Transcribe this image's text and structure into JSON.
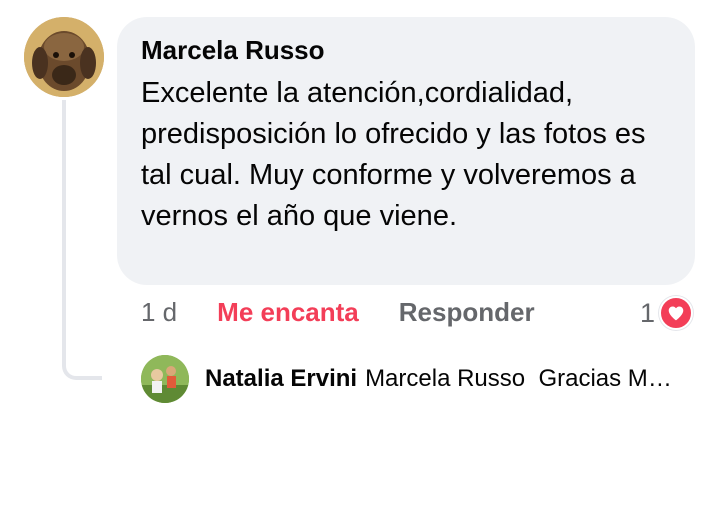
{
  "comment": {
    "author": "Marcela Russo",
    "text": "Excelente la atención,cordialidad, predisposición lo ofrecido y las fotos es tal cual. Muy conforme y volveremos a vernos el año que viene.",
    "time": "1 d",
    "react_label": "Me encanta",
    "reply_label": "Responder",
    "reaction_count": "1",
    "reaction_icon": "heart-icon"
  },
  "reply": {
    "author": "Natalia Ervini",
    "text": "Marcela Russo  Gracias Marcela!"
  },
  "colors": {
    "bubble": "#f0f2f5",
    "love": "#f33e58",
    "secondary_text": "#65676b",
    "thread_line": "#e4e6eb"
  }
}
